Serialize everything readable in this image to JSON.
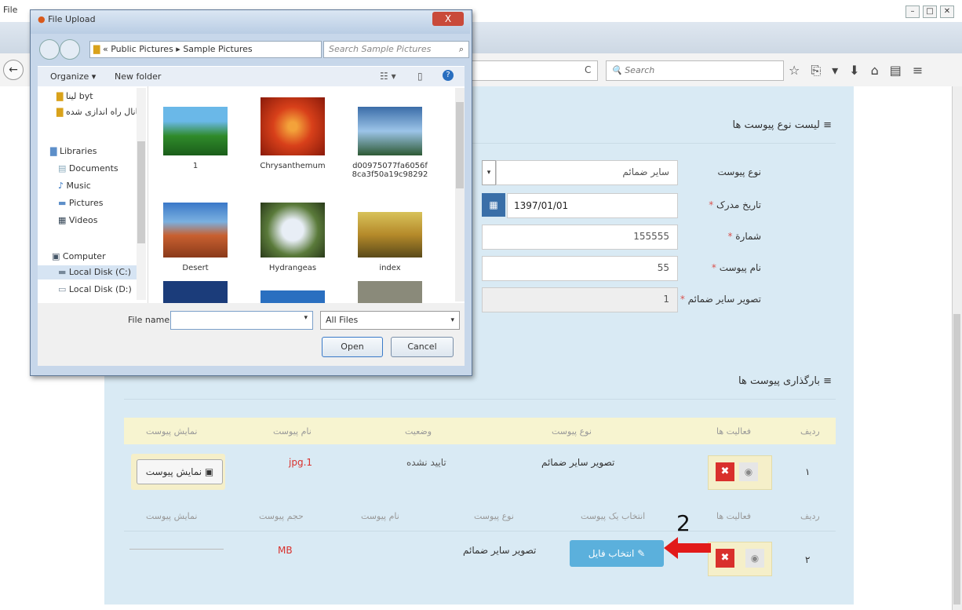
{
  "browser": {
    "menu_file": "File",
    "search_placeholder": "Search",
    "reload": "C",
    "toolbar_icons": "☆⎘▾⬇⌂▤≡"
  },
  "section1": {
    "title": "لیست نوع پیوست ها",
    "fields": [
      {
        "label": "نوع پیوست",
        "value": "سایر ضمائم",
        "required": false
      },
      {
        "label": "تاریخ مدرک",
        "value": "1397/01/01",
        "required": true
      },
      {
        "label": "شمارة",
        "value": "155555",
        "required": true
      },
      {
        "label": "نام پیوست",
        "value": "55",
        "required": true
      },
      {
        "label": "تصویر سایر ضمائم",
        "value": "1",
        "required": true
      }
    ],
    "required_mark": "*"
  },
  "section2": {
    "title": "بارگذاری پیوست ها",
    "table1": {
      "headers": [
        "ردیف",
        "فعالیت ها",
        "نوع پیوست",
        "وضعیت",
        "نام پیوست",
        "نمایش پیوست"
      ],
      "row": {
        "index": "١",
        "type": "تصویر سایر ضمائم",
        "status": "تایید نشده",
        "file": "jpg.1",
        "view_button": "نمایش پیوست"
      }
    },
    "table2": {
      "headers": [
        "ردیف",
        "فعالیت ها",
        "انتخاب یک پیوست",
        "نوع پیوست",
        "نام پیوست",
        "حجم پیوست",
        "نمایش پیوست"
      ],
      "row": {
        "index": "٢",
        "choose_button": "انتخاب فایل",
        "type": "تصویر سایر ضمائم",
        "size": "MB"
      }
    },
    "annotation_number": "2"
  },
  "dialog": {
    "title": "File Upload",
    "close": "X",
    "path": "« Public Pictures ▸ Sample Pictures",
    "search_placeholder": "Search Sample Pictures",
    "organize": "Organize ▾",
    "new_folder": "New folder",
    "tree": [
      {
        "label": "لینا byt"
      },
      {
        "label": "کانال راه اندازی شده"
      },
      {
        "label": "Libraries"
      },
      {
        "label": "Documents"
      },
      {
        "label": "Music"
      },
      {
        "label": "Pictures"
      },
      {
        "label": "Videos"
      },
      {
        "label": "Computer"
      },
      {
        "label": "Local Disk (C:)"
      },
      {
        "label": "Local Disk (D:)"
      }
    ],
    "files": [
      {
        "name": "1",
        "color": "#2f8a2a"
      },
      {
        "name": "Chrysanthemum",
        "color": "#d8401a"
      },
      {
        "name": "d00975077fa6056f8ca3f50a19c98292",
        "color": "#3b6da8"
      },
      {
        "name": "Desert",
        "color": "#b5532a"
      },
      {
        "name": "Hydrangeas",
        "color": "#5a7a3a"
      },
      {
        "name": "index",
        "color": "#b58a2a"
      }
    ],
    "file_name_label": "File name:",
    "file_name_value": "",
    "file_type": "All Files",
    "open": "Open",
    "cancel": "Cancel"
  }
}
